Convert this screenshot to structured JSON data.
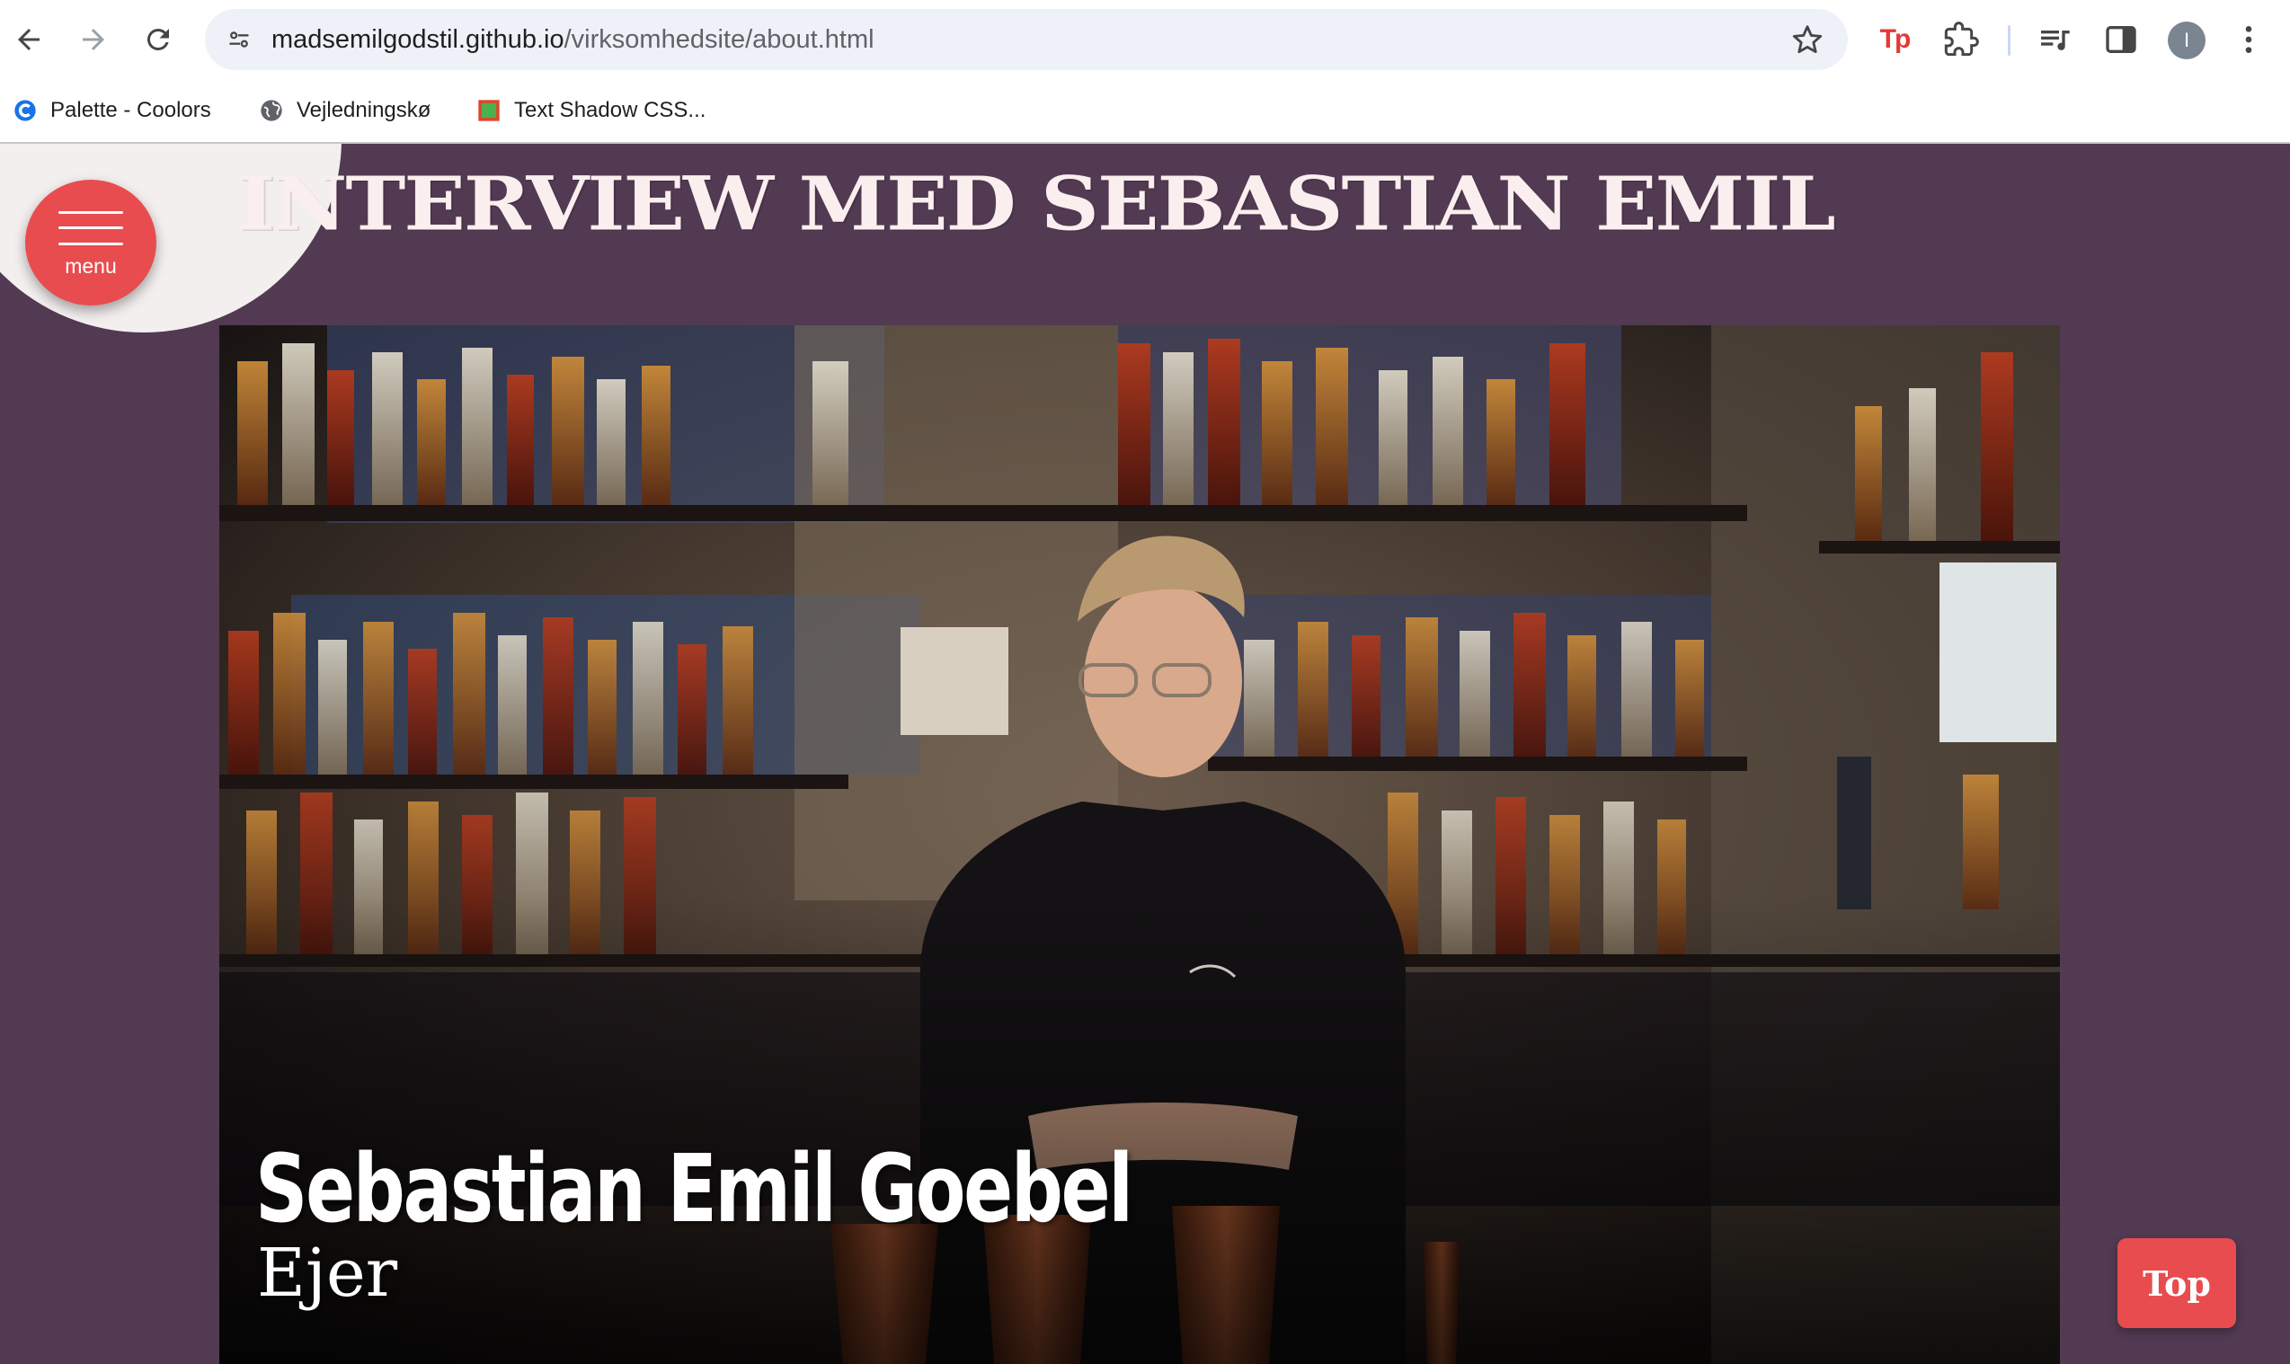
{
  "browser": {
    "url_host": "madsemilgodstil.github.io",
    "url_path": "/virksomhedsite/about.html",
    "extensions": [
      "tp-extension-icon",
      "puzzle-icon",
      "media-queue-icon",
      "side-panel-icon"
    ],
    "avatar_letter": "I"
  },
  "bookmarks": [
    {
      "label": "Palette - Coolors",
      "icon": "coolors-icon"
    },
    {
      "label": "Vejledningskø",
      "icon": "globe-icon"
    },
    {
      "label": "Text Shadow CSS...",
      "icon": "text-shadow-icon"
    }
  ],
  "page": {
    "title": "INTERVIEW MED SEBASTIAN EMIL",
    "menu_label": "menu",
    "top_label": "Top",
    "colors": {
      "background": "#523a52",
      "accent": "#e84c4f",
      "title": "#fbeeee"
    }
  },
  "video": {
    "person_name": "Sebastian Emil Goebel",
    "person_role": "Ejer"
  }
}
